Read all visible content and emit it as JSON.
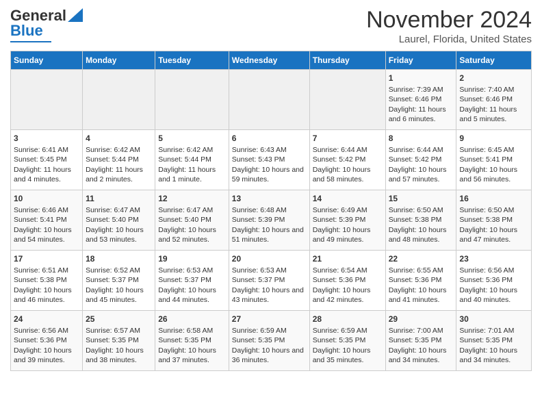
{
  "logo": {
    "line1": "General",
    "line2": "Blue"
  },
  "title": "November 2024",
  "subtitle": "Laurel, Florida, United States",
  "days_of_week": [
    "Sunday",
    "Monday",
    "Tuesday",
    "Wednesday",
    "Thursday",
    "Friday",
    "Saturday"
  ],
  "weeks": [
    [
      {
        "day": "",
        "empty": true
      },
      {
        "day": "",
        "empty": true
      },
      {
        "day": "",
        "empty": true
      },
      {
        "day": "",
        "empty": true
      },
      {
        "day": "",
        "empty": true
      },
      {
        "day": "1",
        "sunrise": "Sunrise: 7:39 AM",
        "sunset": "Sunset: 6:46 PM",
        "daylight": "Daylight: 11 hours and 6 minutes."
      },
      {
        "day": "2",
        "sunrise": "Sunrise: 7:40 AM",
        "sunset": "Sunset: 6:46 PM",
        "daylight": "Daylight: 11 hours and 5 minutes."
      }
    ],
    [
      {
        "day": "3",
        "sunrise": "Sunrise: 6:41 AM",
        "sunset": "Sunset: 5:45 PM",
        "daylight": "Daylight: 11 hours and 4 minutes."
      },
      {
        "day": "4",
        "sunrise": "Sunrise: 6:42 AM",
        "sunset": "Sunset: 5:44 PM",
        "daylight": "Daylight: 11 hours and 2 minutes."
      },
      {
        "day": "5",
        "sunrise": "Sunrise: 6:42 AM",
        "sunset": "Sunset: 5:44 PM",
        "daylight": "Daylight: 11 hours and 1 minute."
      },
      {
        "day": "6",
        "sunrise": "Sunrise: 6:43 AM",
        "sunset": "Sunset: 5:43 PM",
        "daylight": "Daylight: 10 hours and 59 minutes."
      },
      {
        "day": "7",
        "sunrise": "Sunrise: 6:44 AM",
        "sunset": "Sunset: 5:42 PM",
        "daylight": "Daylight: 10 hours and 58 minutes."
      },
      {
        "day": "8",
        "sunrise": "Sunrise: 6:44 AM",
        "sunset": "Sunset: 5:42 PM",
        "daylight": "Daylight: 10 hours and 57 minutes."
      },
      {
        "day": "9",
        "sunrise": "Sunrise: 6:45 AM",
        "sunset": "Sunset: 5:41 PM",
        "daylight": "Daylight: 10 hours and 56 minutes."
      }
    ],
    [
      {
        "day": "10",
        "sunrise": "Sunrise: 6:46 AM",
        "sunset": "Sunset: 5:41 PM",
        "daylight": "Daylight: 10 hours and 54 minutes."
      },
      {
        "day": "11",
        "sunrise": "Sunrise: 6:47 AM",
        "sunset": "Sunset: 5:40 PM",
        "daylight": "Daylight: 10 hours and 53 minutes."
      },
      {
        "day": "12",
        "sunrise": "Sunrise: 6:47 AM",
        "sunset": "Sunset: 5:40 PM",
        "daylight": "Daylight: 10 hours and 52 minutes."
      },
      {
        "day": "13",
        "sunrise": "Sunrise: 6:48 AM",
        "sunset": "Sunset: 5:39 PM",
        "daylight": "Daylight: 10 hours and 51 minutes."
      },
      {
        "day": "14",
        "sunrise": "Sunrise: 6:49 AM",
        "sunset": "Sunset: 5:39 PM",
        "daylight": "Daylight: 10 hours and 49 minutes."
      },
      {
        "day": "15",
        "sunrise": "Sunrise: 6:50 AM",
        "sunset": "Sunset: 5:38 PM",
        "daylight": "Daylight: 10 hours and 48 minutes."
      },
      {
        "day": "16",
        "sunrise": "Sunrise: 6:50 AM",
        "sunset": "Sunset: 5:38 PM",
        "daylight": "Daylight: 10 hours and 47 minutes."
      }
    ],
    [
      {
        "day": "17",
        "sunrise": "Sunrise: 6:51 AM",
        "sunset": "Sunset: 5:38 PM",
        "daylight": "Daylight: 10 hours and 46 minutes."
      },
      {
        "day": "18",
        "sunrise": "Sunrise: 6:52 AM",
        "sunset": "Sunset: 5:37 PM",
        "daylight": "Daylight: 10 hours and 45 minutes."
      },
      {
        "day": "19",
        "sunrise": "Sunrise: 6:53 AM",
        "sunset": "Sunset: 5:37 PM",
        "daylight": "Daylight: 10 hours and 44 minutes."
      },
      {
        "day": "20",
        "sunrise": "Sunrise: 6:53 AM",
        "sunset": "Sunset: 5:37 PM",
        "daylight": "Daylight: 10 hours and 43 minutes."
      },
      {
        "day": "21",
        "sunrise": "Sunrise: 6:54 AM",
        "sunset": "Sunset: 5:36 PM",
        "daylight": "Daylight: 10 hours and 42 minutes."
      },
      {
        "day": "22",
        "sunrise": "Sunrise: 6:55 AM",
        "sunset": "Sunset: 5:36 PM",
        "daylight": "Daylight: 10 hours and 41 minutes."
      },
      {
        "day": "23",
        "sunrise": "Sunrise: 6:56 AM",
        "sunset": "Sunset: 5:36 PM",
        "daylight": "Daylight: 10 hours and 40 minutes."
      }
    ],
    [
      {
        "day": "24",
        "sunrise": "Sunrise: 6:56 AM",
        "sunset": "Sunset: 5:36 PM",
        "daylight": "Daylight: 10 hours and 39 minutes."
      },
      {
        "day": "25",
        "sunrise": "Sunrise: 6:57 AM",
        "sunset": "Sunset: 5:35 PM",
        "daylight": "Daylight: 10 hours and 38 minutes."
      },
      {
        "day": "26",
        "sunrise": "Sunrise: 6:58 AM",
        "sunset": "Sunset: 5:35 PM",
        "daylight": "Daylight: 10 hours and 37 minutes."
      },
      {
        "day": "27",
        "sunrise": "Sunrise: 6:59 AM",
        "sunset": "Sunset: 5:35 PM",
        "daylight": "Daylight: 10 hours and 36 minutes."
      },
      {
        "day": "28",
        "sunrise": "Sunrise: 6:59 AM",
        "sunset": "Sunset: 5:35 PM",
        "daylight": "Daylight: 10 hours and 35 minutes."
      },
      {
        "day": "29",
        "sunrise": "Sunrise: 7:00 AM",
        "sunset": "Sunset: 5:35 PM",
        "daylight": "Daylight: 10 hours and 34 minutes."
      },
      {
        "day": "30",
        "sunrise": "Sunrise: 7:01 AM",
        "sunset": "Sunset: 5:35 PM",
        "daylight": "Daylight: 10 hours and 34 minutes."
      }
    ]
  ]
}
